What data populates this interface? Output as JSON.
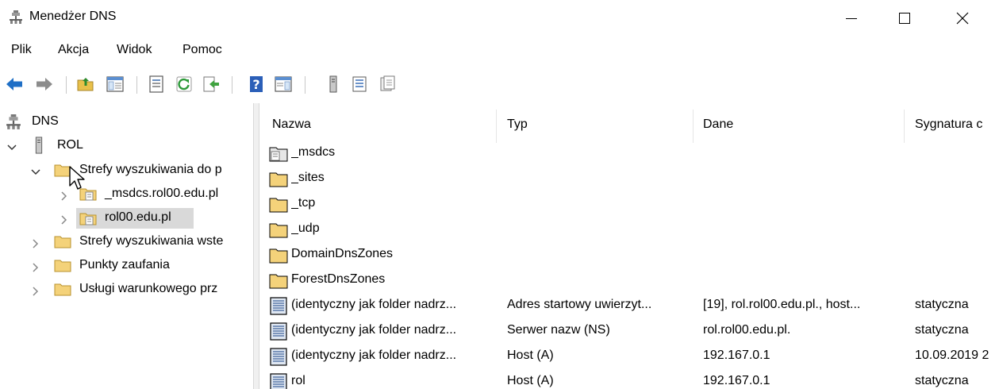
{
  "window": {
    "title": "Menedżer DNS"
  },
  "menu": [
    "Plik",
    "Akcja",
    "Widok",
    "Pomoc"
  ],
  "toolbar": {
    "icons": [
      "back-icon",
      "forward-icon",
      "up-folder-icon",
      "show-console-tree-icon",
      "properties-icon",
      "refresh-icon",
      "export-list-icon",
      "help-icon",
      "show-action-pane-icon",
      "server-icon",
      "zone-list-icon",
      "zone-details-icon"
    ]
  },
  "tree": {
    "root": "DNS",
    "server": "ROL",
    "forward_zones": "Strefy wyszukiwania do p",
    "zone_msdcs": "_msdcs.rol00.edu.pl",
    "zone_main": "rol00.edu.pl",
    "reverse_zones": "Strefy wyszukiwania wste",
    "trust_points": "Punkty zaufania",
    "conditional": "Usługi warunkowego prz"
  },
  "list": {
    "columns": [
      "Nazwa",
      "Typ",
      "Dane",
      "Sygnatura c"
    ],
    "rows": [
      {
        "icon": "zone-icon",
        "name": "_msdcs",
        "type": "",
        "data": "",
        "sig": ""
      },
      {
        "icon": "folder-icon",
        "name": "_sites",
        "type": "",
        "data": "",
        "sig": ""
      },
      {
        "icon": "folder-icon",
        "name": "_tcp",
        "type": "",
        "data": "",
        "sig": ""
      },
      {
        "icon": "folder-icon",
        "name": "_udp",
        "type": "",
        "data": "",
        "sig": ""
      },
      {
        "icon": "folder-icon",
        "name": "DomainDnsZones",
        "type": "",
        "data": "",
        "sig": ""
      },
      {
        "icon": "folder-icon",
        "name": "ForestDnsZones",
        "type": "",
        "data": "",
        "sig": ""
      },
      {
        "icon": "record-icon",
        "name": "(identyczny jak folder nadrz...",
        "type": "Adres startowy uwierzyt...",
        "data": "[19], rol.rol00.edu.pl., host...",
        "sig": "statyczna"
      },
      {
        "icon": "record-icon",
        "name": "(identyczny jak folder nadrz...",
        "type": "Serwer nazw (NS)",
        "data": "rol.rol00.edu.pl.",
        "sig": "statyczna"
      },
      {
        "icon": "record-icon",
        "name": "(identyczny jak folder nadrz...",
        "type": "Host (A)",
        "data": "192.167.0.1",
        "sig": "10.09.2019 2"
      },
      {
        "icon": "record-icon",
        "name": "rol",
        "type": "Host (A)",
        "data": "192.167.0.1",
        "sig": "statyczna"
      }
    ]
  }
}
